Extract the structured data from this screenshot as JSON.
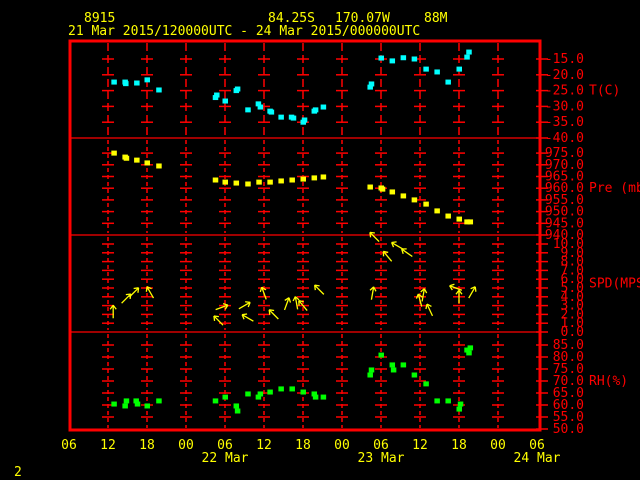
{
  "header": {
    "station": "8915",
    "lat": "84.25S",
    "lon": "170.07W",
    "elev": "88M",
    "period": "21 Mar 2015/120000UTC - 24 Mar 2015/000000UTC"
  },
  "footer": {
    "page": "2"
  },
  "colors": {
    "frame": "#ff0000",
    "text": "#ffff00",
    "temp": "#00ffff",
    "pressure": "#ffff00",
    "wind": "#ffff00",
    "rh": "#00ff00"
  },
  "chart_data": [
    {
      "type": "scatter",
      "title": "T(C)",
      "ylabel": "T(C)",
      "ylim": [
        -40,
        -10
      ],
      "yticks": [
        "-15.0",
        "-20.0",
        "-25.0",
        "-30.0",
        "-35.0",
        "-40.0"
      ],
      "ytick_values": [
        -15,
        -20,
        -25,
        -30,
        -35,
        -40
      ],
      "x_unit": "hours since 21 Mar 06UTC",
      "x": [
        6.9,
        8.6,
        8.7,
        10.4,
        12,
        13.8,
        22.5,
        22.7,
        24,
        25.7,
        25.9,
        27.5,
        29.1,
        29.4,
        30.9,
        31.1,
        32.6,
        34.2,
        34.5,
        36.2,
        36,
        37.7,
        37.9,
        39.1,
        46.3,
        46.5,
        48,
        49.7,
        51.4,
        53.1,
        54.9,
        56.6,
        58.3,
        60,
        61.2,
        61.5
      ],
      "y": [
        -22.3,
        -22.3,
        -22.8,
        -22.6,
        -21.6,
        -24.8,
        -27.2,
        -26.4,
        -28.3,
        -25,
        -24.5,
        -31.1,
        -29.2,
        -30.2,
        -31.5,
        -31.8,
        -33.4,
        -33.4,
        -33.7,
        -34.3,
        -35,
        -31.5,
        -31.1,
        -30.2,
        -23.9,
        -22.9,
        -14.7,
        -15.6,
        -14.6,
        -15,
        -18.2,
        -19.1,
        -22.3,
        -18.2,
        -14.4,
        -12.8
      ]
    },
    {
      "type": "scatter",
      "title": "Pre (mb)",
      "ylabel": "Pre (mb)",
      "ylim": [
        940,
        980
      ],
      "yticks": [
        "975.0",
        "970.0",
        "965.0",
        "960.0",
        "955.0",
        "950.0",
        "945.0",
        "940.0"
      ],
      "ytick_values": [
        975,
        970,
        965,
        960,
        955,
        950,
        945,
        940
      ],
      "x": [
        6.9,
        8.6,
        8.8,
        10.4,
        12,
        13.8,
        22.5,
        24,
        25.7,
        27.5,
        29.2,
        30.9,
        32.6,
        34.3,
        36,
        37.7,
        39.1,
        46.3,
        48,
        48.2,
        49.7,
        51.4,
        53.1,
        54.9,
        56.6,
        58.3,
        60,
        61.2,
        61.7
      ],
      "y": [
        975,
        973.3,
        972.8,
        972,
        970.8,
        969.5,
        963.5,
        962.6,
        962.2,
        961.8,
        962.6,
        962.6,
        963.1,
        963.5,
        963.9,
        964.4,
        964.8,
        960.5,
        960.1,
        959.6,
        958.4,
        956.7,
        955,
        953.2,
        950.3,
        948.1,
        946.8,
        945.6,
        945.6
      ]
    },
    {
      "type": "vector",
      "title": "SPD(MPS)",
      "ylabel": "SPD(MPS)",
      "ylim": [
        0,
        10.5
      ],
      "yticks": [
        "10.0",
        "9.0",
        "8.0",
        "7.0",
        "6.0",
        "5.0",
        "4.0",
        "3.0",
        "2.0",
        "1.0",
        "0.0"
      ],
      "ytick_values": [
        10,
        9,
        8,
        7,
        6,
        5,
        4,
        3,
        2,
        1,
        0
      ],
      "x": [
        6.8,
        8.8,
        10,
        12.5,
        23.5,
        23,
        27,
        27.5,
        30,
        31.5,
        33.5,
        35,
        36,
        38.5,
        47,
        46.7,
        49,
        50.5,
        52,
        54.5,
        55.5,
        54,
        59.5,
        60,
        62
      ],
      "speed": [
        2.3,
        3.8,
        4.5,
        4.5,
        2.8,
        1.3,
        3,
        1.6,
        4.4,
        2,
        3.2,
        3.3,
        3,
        4.8,
        10.8,
        4.4,
        8.6,
        9.8,
        9,
        4.2,
        2.5,
        3.6,
        5,
        4,
        4.5
      ],
      "arrow_dir_deg": [
        0,
        45,
        45,
        330,
        70,
        315,
        60,
        300,
        340,
        315,
        20,
        350,
        320,
        315,
        315,
        10,
        320,
        300,
        305,
        10,
        335,
        345,
        290,
        0,
        30
      ]
    },
    {
      "type": "scatter",
      "title": "RH(%)",
      "ylabel": "RH(%)",
      "ylim": [
        50,
        88
      ],
      "yticks": [
        "85.0",
        "80.0",
        "75.0",
        "70.0",
        "65.0",
        "60.0",
        "55.0",
        "50.0"
      ],
      "ytick_values": [
        85,
        80,
        75,
        70,
        65,
        60,
        55,
        50
      ],
      "x": [
        6.9,
        8.6,
        8.8,
        10.3,
        10.5,
        12,
        13.8,
        22.5,
        24,
        25.7,
        25.9,
        27.5,
        29.1,
        29.4,
        30.9,
        32.6,
        34.3,
        36,
        37.7,
        37.9,
        39.1,
        46.3,
        46.5,
        48,
        49.7,
        49.9,
        51.4,
        53.1,
        54.9,
        56.6,
        58.3,
        60.2,
        60,
        61.2,
        61.7,
        61.5
      ],
      "y": [
        60.4,
        59.6,
        61.7,
        61.7,
        60.4,
        59.6,
        61.7,
        61.7,
        63.3,
        59.6,
        57.5,
        64.6,
        63.3,
        64.6,
        65.4,
        66.7,
        66.7,
        65.4,
        64.6,
        63.3,
        63.3,
        72.5,
        74.6,
        80.8,
        76.7,
        74.6,
        76.7,
        72.5,
        68.8,
        61.7,
        61.7,
        60.4,
        58.3,
        82.9,
        83.8,
        81.7
      ]
    }
  ],
  "time_axis": {
    "xlim_hours": [
      0,
      72
    ],
    "tick_labels": [
      "06",
      "12",
      "18",
      "00",
      "06",
      "12",
      "18",
      "00",
      "06",
      "12",
      "18",
      "00",
      "06"
    ],
    "date_labels": [
      {
        "label": "22 Mar",
        "hour": 24
      },
      {
        "label": "23 Mar",
        "hour": 48
      },
      {
        "label": "24 Mar",
        "hour": 72
      }
    ]
  }
}
